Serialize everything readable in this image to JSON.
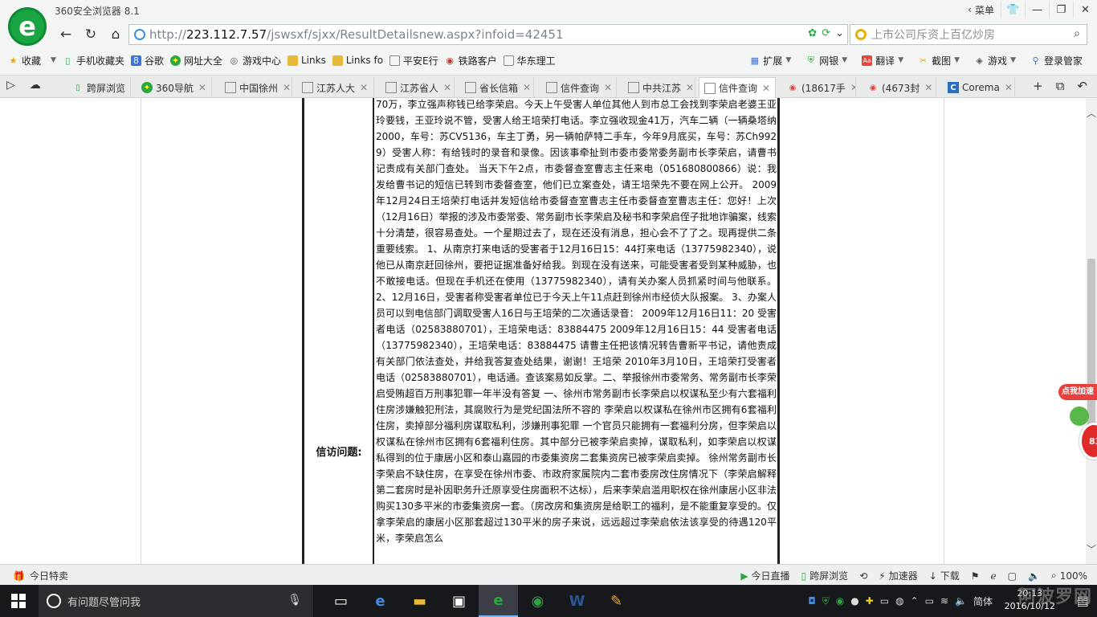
{
  "window": {
    "app_title": "360安全浏览器 8.1",
    "menu_label": "菜单"
  },
  "toolbar": {
    "url_prefix": "http://",
    "url_host": "223.112.7.57",
    "url_path": "/jswsxf/sjxx/ResultDetailsnew.aspx?infoid=42451",
    "search_placeholder": "上市公司斥资上百亿炒房"
  },
  "bookmarks": [
    {
      "label": "收藏",
      "icon": "star-icon",
      "color": "#e6a817"
    },
    {
      "label": "手机收藏夹",
      "icon": "phone-icon",
      "color": "#2aa743"
    },
    {
      "label": "谷歌",
      "icon": "google-icon",
      "color": "#3b73d9"
    },
    {
      "label": "网址大全",
      "icon": "globe-icon",
      "color": "#2aa743"
    },
    {
      "label": "游戏中心",
      "icon": "gamepad-icon",
      "color": "#555"
    },
    {
      "label": "Links",
      "icon": "folder-icon",
      "color": "#e6b93b"
    },
    {
      "label": "Links fo",
      "icon": "folder-icon",
      "color": "#e6b93b"
    },
    {
      "label": "平安E行",
      "icon": "page-icon",
      "color": "#777"
    },
    {
      "label": "铁路客户",
      "icon": "rail-icon",
      "color": "#c0392b"
    },
    {
      "label": "华东理工",
      "icon": "page-icon",
      "color": "#777"
    }
  ],
  "bookmark_tools": [
    {
      "label": "扩展",
      "icon": "extension-icon"
    },
    {
      "label": "网银",
      "icon": "bank-icon"
    },
    {
      "label": "翻译",
      "icon": "translate-icon"
    },
    {
      "label": "截图",
      "icon": "screenshot-icon"
    },
    {
      "label": "游戏",
      "icon": "game-icon"
    },
    {
      "label": "登录管家",
      "icon": "login-icon"
    }
  ],
  "tabs": [
    {
      "label": "跨屏浏览",
      "icon": "phone-icon",
      "active": false,
      "pinned": true
    },
    {
      "label": "360导航",
      "icon": "360-icon",
      "active": false
    },
    {
      "label": "中国徐州",
      "icon": "page-icon",
      "active": false
    },
    {
      "label": "江苏人大",
      "icon": "page-icon",
      "active": false
    },
    {
      "label": "江苏省人",
      "icon": "page-icon",
      "active": false
    },
    {
      "label": "省长信箱",
      "icon": "page-icon",
      "active": false
    },
    {
      "label": "信件查询",
      "icon": "page-icon",
      "active": false
    },
    {
      "label": "中共江苏",
      "icon": "page-icon",
      "active": false
    },
    {
      "label": "信件查询",
      "icon": "page-icon",
      "active": true
    },
    {
      "label": "(18617手",
      "icon": "weibo-icon",
      "active": false
    },
    {
      "label": "(4673封",
      "icon": "weibo-icon",
      "active": false
    },
    {
      "label": "Corema",
      "icon": "c-icon",
      "active": false
    }
  ],
  "content": {
    "field_label": "信访问题:",
    "body": "70万，李立强声称钱已给李荣启。今天上午受害人单位其他人到市总工会找到李荣启老婆王亚玲要钱，王亚玲说不管，受害人给王培荣打电话。李立强收现金41万，汽车二辆（一辆桑塔纳2000，车号：苏CV5136，车主丁勇，另一辆帕萨特二手车，今年9月底买，车号：苏Ch9929）受害人称：有给钱时的录音和录像。因该事牵扯到市委市委常委务副市长李荣启，请曹书记责成有关部门查处。 当天下午2点，市委督查室曹志主任来电（051680800866）说：我发给曹书记的短信已转到市委督查室，他们已立案查处，请王培荣先不要在网上公开。 2009年12月24日王培荣打电话并发短信给市委督查室曹志主任市委督查室曹志主任：您好！上次（12月16日）举报的涉及市委常委、常务副市长李荣启及秘书和李荣启侄子批地诈骗案，线索十分清楚，很容易查处。一个星期过去了，现在还没有消息，担心会不了了之。现再提供二条重要线索。 1、从南京打来电话的受害者于12月16日15：44打来电话（13775982340），说他已从南京赶回徐州，要把证据准备好给我。到现在没有送来，可能受害者受到某种威胁，也不敢接电话。但现在手机还在使用（13775982340），请有关办案人员抓紧时间与他联系。 2、12月16日，受害者称受害者单位已于今天上午11点赶到徐州市经侦大队报案。 3、办案人员可以到电信部门调取受害人16日与王培荣的二次通话录音： 2009年12月16日11：20 受害者电话（02583880701），王培荣电话：83884475 2009年12月16日15：44 受害者电话（13775982340），王培荣电话：83884475 请曹主任把该情况转告曹新平书记，请他责成有关部门依法查处，并给我答复查处结果，谢谢！王培荣 2010年3月10日，王培荣打受害者电话（02583880701），电话通。查该案易如反掌。二、举报徐州市委常务、常务副市长李荣启受贿超百万刑事犯罪一年半没有答复 一、徐州市常务副市长李荣启以权谋私至少有六套福利住房涉嫌触犯刑法，其腐败行为是党纪国法所不容的 李荣启以权谋私在徐州市区拥有6套福利住房，卖掉部分福利房谋取私利，涉嫌刑事犯罪 一个官员只能拥有一套福利分房，但李荣启以权谋私在徐州市区拥有6套福利住房。其中部分已被李荣启卖掉，谋取私利，如李荣启以权谋私得到的位于康居小区和泰山嘉园的市委集资房二套集资房已被李荣启卖掉。 徐州常务副市长李荣启不缺住房，在享受在徐州市委、市政府家属院内二套市委房改住房情况下（李荣启解释第二套房时是补因职务升迁原享受住房面积不达标），后来李荣启滥用职权在徐州康居小区非法购买130多平米的市委集资房一套。（房改房和集资房是给职工的福利，是不能重复享受的。仅拿李荣启的康居小区那套超过130平米的房子来说，远远超过李荣启依法该享受的待遇120平米，李荣启怎么"
  },
  "float_widget": {
    "label": "点我加速",
    "count": "83"
  },
  "statusbar": {
    "left": "今日特卖",
    "items": [
      {
        "label": "今日直播",
        "icon": "play-icon"
      },
      {
        "label": "跨屏浏览",
        "icon": "phone-icon"
      },
      {
        "label": "",
        "icon": "refresh-icon"
      },
      {
        "label": "加速器",
        "icon": "rocket-icon"
      },
      {
        "label": "下载",
        "icon": "download-icon"
      },
      {
        "label": "",
        "icon": "flag-icon"
      },
      {
        "label": "",
        "icon": "ie-icon"
      },
      {
        "label": "",
        "icon": "window-icon"
      },
      {
        "label": "",
        "icon": "volume-icon"
      },
      {
        "label": "100%",
        "icon": "zoom-icon"
      }
    ]
  },
  "taskbar": {
    "search_placeholder": "有问题尽管问我",
    "apps": [
      {
        "name": "task-view-icon",
        "glyph": "▭"
      },
      {
        "name": "edge-icon",
        "glyph": "e"
      },
      {
        "name": "explorer-icon",
        "glyph": "▬"
      },
      {
        "name": "store-icon",
        "glyph": "▣"
      },
      {
        "name": "browser-360-icon",
        "glyph": "e"
      },
      {
        "name": "wechat-icon",
        "glyph": "◉"
      },
      {
        "name": "word-icon",
        "glyph": "W"
      },
      {
        "name": "paint-icon",
        "glyph": "✎"
      }
    ],
    "ime": "简体",
    "time": "20:13",
    "date": "2016/10/12",
    "watermark": "阿波罗网"
  }
}
